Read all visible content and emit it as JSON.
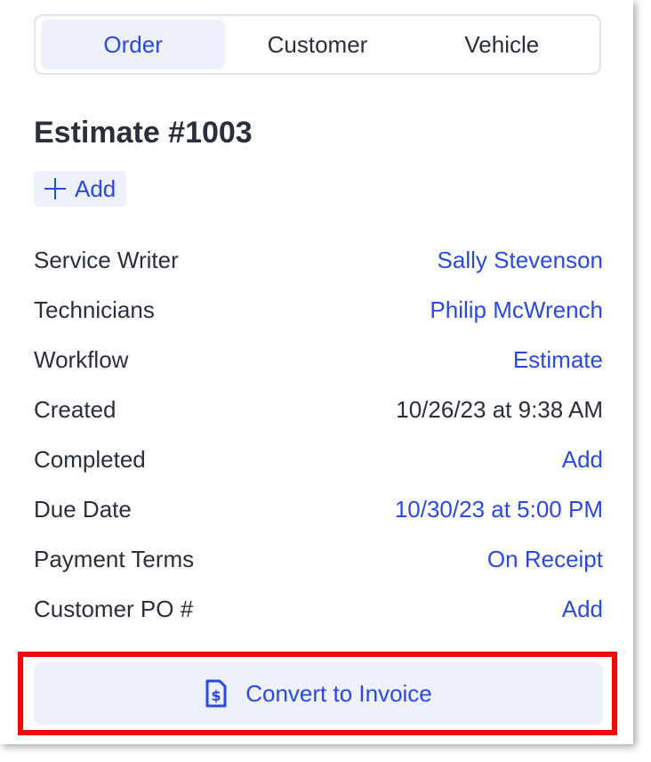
{
  "tabs": [
    {
      "label": "Order",
      "active": true
    },
    {
      "label": "Customer",
      "active": false
    },
    {
      "label": "Vehicle",
      "active": false
    }
  ],
  "title": "Estimate #1003",
  "add_label": "Add",
  "fields": [
    {
      "label": "Service Writer",
      "value": "Sally Stevenson"
    },
    {
      "label": "Technicians",
      "value": "Philip McWrench"
    },
    {
      "label": "Workflow",
      "value": "Estimate"
    },
    {
      "label": "Created",
      "value": "10/26/23 at 9:38 AM"
    },
    {
      "label": "Completed",
      "value": "Add"
    },
    {
      "label": "Due Date",
      "value": "10/30/23 at 5:00 PM"
    },
    {
      "label": "Payment Terms",
      "value": "On Receipt"
    },
    {
      "label": "Customer PO #",
      "value": "Add"
    }
  ],
  "convert_button": {
    "label": "Convert to Invoice",
    "icon": "invoice-dollar-icon"
  },
  "colors": {
    "accent": "#2a49e0",
    "highlight": "#ee0a0a",
    "chip_bg": "#eef0fb"
  }
}
